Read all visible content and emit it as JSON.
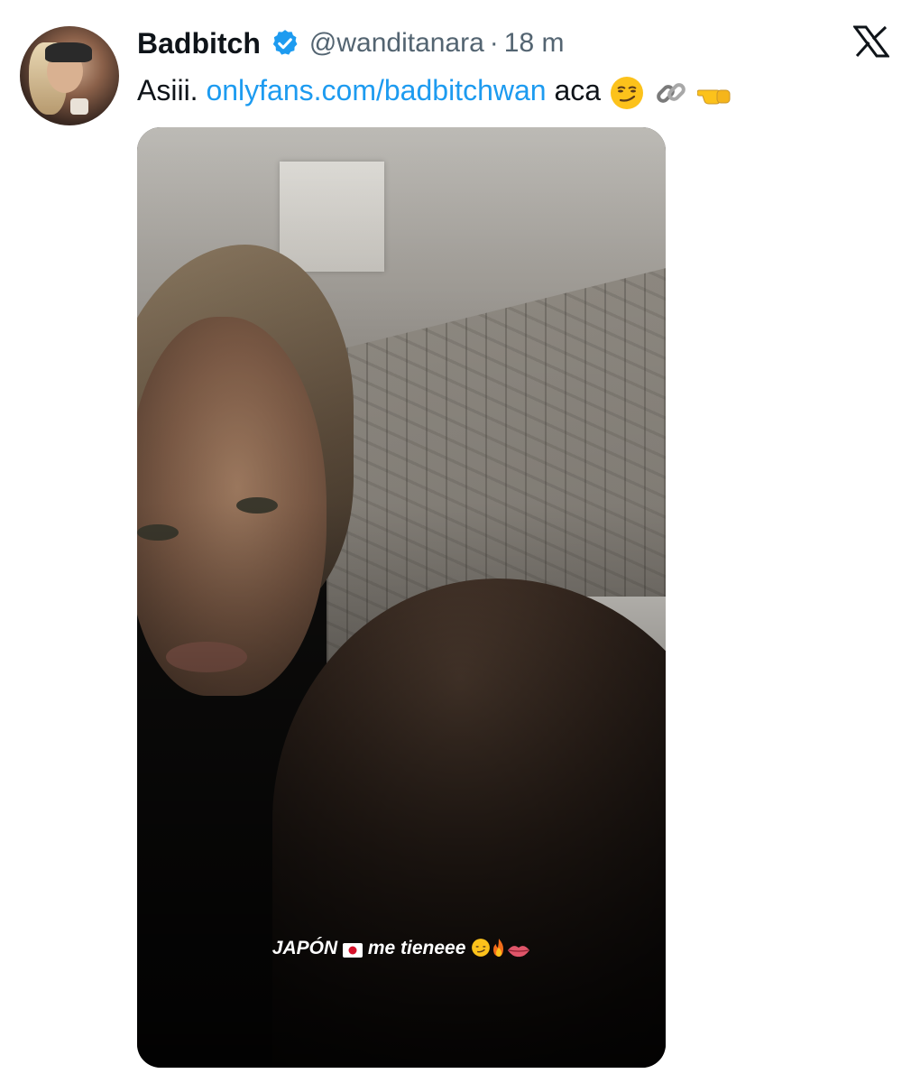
{
  "tweet": {
    "display_name": "Badbitch",
    "handle": "@wanditanara",
    "separator": "·",
    "time": "18 m",
    "text_prefix": "Asiii. ",
    "link_text": "onlyfans.com/badbitchwan",
    "text_suffix": " aca",
    "text_emojis": [
      "smirk-emoji",
      "link-emoji",
      "pointing-left-emoji"
    ]
  },
  "media": {
    "caption_word1": "JAPÓN",
    "caption_word2": "me tieneee",
    "caption_emojis": [
      "japan-flag-emoji",
      "smirk-emoji",
      "fire-emoji",
      "lips-emoji"
    ]
  },
  "colors": {
    "link": "#1d9bf0",
    "verified": "#1d9bf0",
    "secondary_text": "#536471",
    "primary_text": "#0f1419"
  }
}
